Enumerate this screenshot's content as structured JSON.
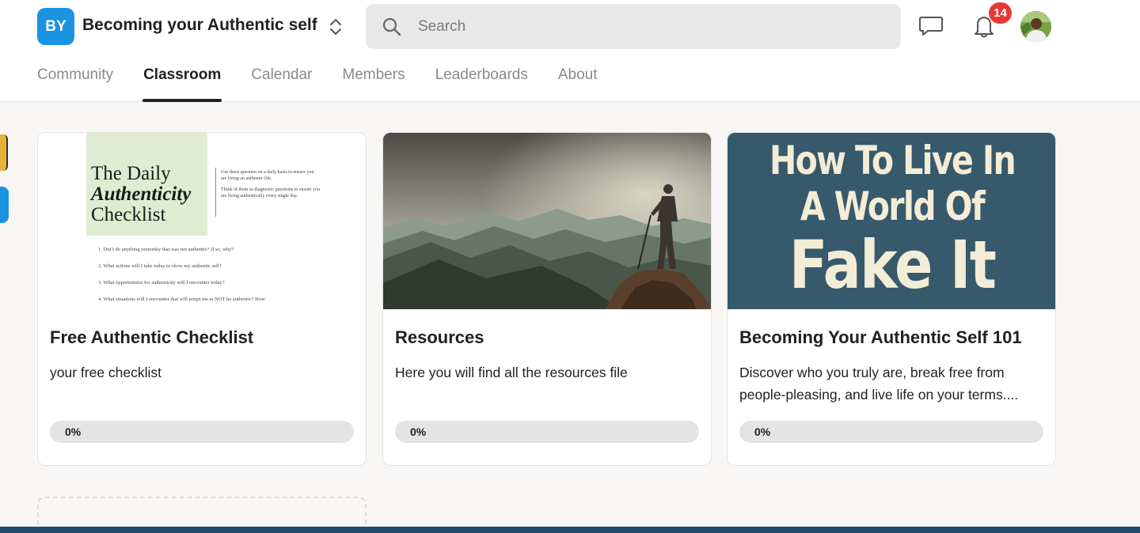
{
  "header": {
    "logo_text": "BY",
    "group_name": "Becoming your Authentic self",
    "search_placeholder": "Search",
    "notification_count": "14",
    "colors": {
      "logo": "#1a93e0",
      "badge": "#e53935"
    }
  },
  "tabs": [
    {
      "label": "Community",
      "active": false
    },
    {
      "label": "Classroom",
      "active": true
    },
    {
      "label": "Calendar",
      "active": false
    },
    {
      "label": "Members",
      "active": false
    },
    {
      "label": "Leaderboards",
      "active": false
    },
    {
      "label": "About",
      "active": false
    }
  ],
  "courses": [
    {
      "title": "Free Authentic Checklist",
      "description": "your free checklist",
      "progress_label": "0%",
      "progress": 0,
      "thumbnail": {
        "title_line1": "The Daily",
        "title_line2": "Authenticity",
        "title_line3": "Checklist",
        "side_text_1": "Use these question on a daily basis to ensure you are living an authentic life.",
        "side_text_2": "Think of them as diagnostic questions to ensure you are living authentically every single day.",
        "items": [
          "1.  Did I do anything yesterday that was not authentic? If so, why?",
          "2.  What actions will I take today to show my authentic self?",
          "3.  What opportunities for authenticity will I encounter today?",
          "4.  What situations will I encounter that will tempt me to NOT be authentic? How"
        ]
      }
    },
    {
      "title": "Resources",
      "description": "Here you will find all the resources file",
      "progress_label": "0%",
      "progress": 0
    },
    {
      "title": "Becoming Your Authentic Self 101",
      "description": "Discover who you truly are, break free from people-pleasing, and live life on your terms....",
      "progress_label": "0%",
      "progress": 0,
      "thumbnail": {
        "line1": "How To Live In",
        "line2": "A World Of",
        "line3": "Fake  It"
      }
    }
  ],
  "icons": [
    "switcher-icon",
    "search-icon",
    "chat-icon",
    "bell-icon"
  ]
}
